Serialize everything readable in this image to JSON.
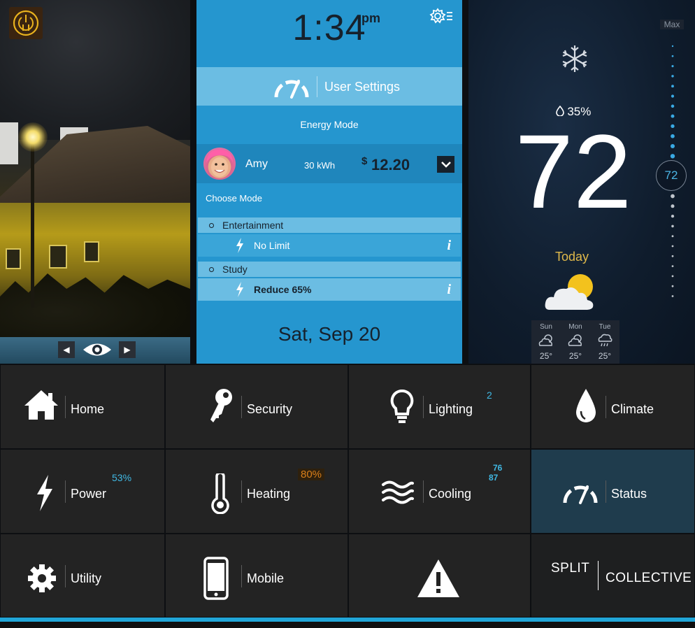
{
  "center": {
    "time": "1:34",
    "ampm": "pm",
    "user_settings_label": "User Settings",
    "energy_mode_label": "Energy Mode",
    "user": {
      "name": "Amy",
      "kwh": "30 kWh",
      "cost_symbol": "$",
      "cost": "12.20"
    },
    "choose_mode_label": "Choose Mode",
    "modes": [
      {
        "name": "Entertainment",
        "limit": "No Limit"
      },
      {
        "name": "Study",
        "limit": "Reduce 65%"
      }
    ],
    "date": "Sat, Sep 20"
  },
  "climate": {
    "humidity": "35%",
    "temperature": "72",
    "today_label": "Today",
    "max_label": "Max",
    "setpoint": "72",
    "forecast": [
      {
        "day": "Sun",
        "temp": "25°",
        "icon": "partly-cloudy-icon"
      },
      {
        "day": "Mon",
        "temp": "25°",
        "icon": "partly-cloudy-icon"
      },
      {
        "day": "Tue",
        "temp": "25°",
        "icon": "rain-icon"
      }
    ]
  },
  "tiles": {
    "home": "Home",
    "security": "Security",
    "lighting": "Lighting",
    "lighting_badge": "2",
    "climate": "Climate",
    "power": "Power",
    "power_badge": "53%",
    "heating": "Heating",
    "heating_badge": "80%",
    "cooling": "Cooling",
    "cooling_badge_top": "76",
    "cooling_badge_bottom": "87",
    "status": "Status",
    "utility": "Utility",
    "mobile": "Mobile",
    "brand_line1": "SPLIT",
    "brand_line2": "COLLECTIVE"
  },
  "colors": {
    "accent": "#2596cf",
    "accent_light": "#6bbde3",
    "tile": "#232323",
    "status_tile": "#1f3c4d",
    "badge_blue": "#40b8e3",
    "badge_orange": "#d97f1a",
    "today_gold": "#e0b94b"
  }
}
